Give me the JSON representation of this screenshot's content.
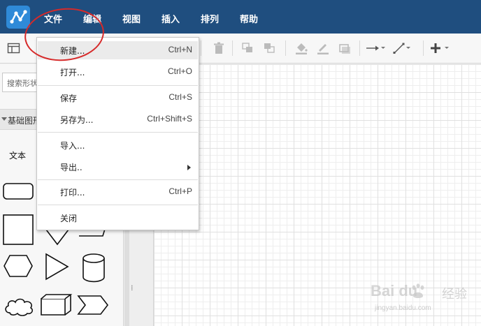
{
  "menubar": {
    "logo_icon": "diagram-logo-icon",
    "items": [
      "文件",
      "编辑",
      "视图",
      "插入",
      "排列",
      "帮助"
    ],
    "background": "#1f4e7f"
  },
  "toolbar": {
    "icons": [
      "panel-toggle-icon",
      "delete-icon",
      "to-front-icon",
      "to-back-icon",
      "fill-color-icon",
      "line-color-icon",
      "shadow-icon",
      "connection-arrow-icon",
      "waypoint-icon",
      "insert-plus-icon"
    ]
  },
  "left_panel": {
    "search_placeholder": "搜索形状",
    "section_title": "基础图形",
    "text_shape_label": "文本"
  },
  "file_menu": {
    "items": [
      {
        "label": "新建...",
        "shortcut": "Ctrl+N",
        "highlighted": true
      },
      {
        "label": "打开...",
        "shortcut": "Ctrl+O"
      },
      {
        "label": "保存",
        "shortcut": "Ctrl+S"
      },
      {
        "label": "另存为...",
        "shortcut": "Ctrl+Shift+S"
      },
      {
        "label": "导入..."
      },
      {
        "label": "导出..",
        "submenu": true
      },
      {
        "label": "打印...",
        "shortcut": "Ctrl+P"
      },
      {
        "label": "关闭"
      }
    ]
  },
  "annotation": {
    "color": "#d62a2a"
  },
  "watermark": {
    "main": "Bai  du",
    "brand": "经验",
    "sub": "jingyan.baidu.com"
  }
}
